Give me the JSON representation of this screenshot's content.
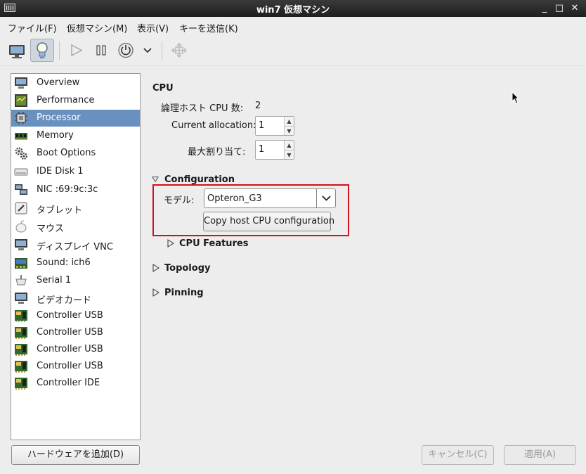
{
  "window": {
    "title": "win7 仮想マシン",
    "minimize": "_",
    "maximize": "□",
    "close": "✕"
  },
  "menu": [
    "ファイル(F)",
    "仮想マシン(M)",
    "表示(V)",
    "キーを送信(K)"
  ],
  "toolbar": [
    "console-monitor-icon",
    "details-lightbulb-icon",
    "run-icon",
    "pause-icon",
    "power-icon",
    "power-menu-chevron-icon",
    "fullscreen-icon"
  ],
  "sidebar": {
    "items": [
      {
        "label": "Overview",
        "icon": "monitor-icon"
      },
      {
        "label": "Performance",
        "icon": "performance-icon"
      },
      {
        "label": "Processor",
        "icon": "cpu-chip-icon"
      },
      {
        "label": "Memory",
        "icon": "memory-icon"
      },
      {
        "label": "Boot Options",
        "icon": "gears-icon"
      },
      {
        "label": "IDE Disk 1",
        "icon": "disk-icon"
      },
      {
        "label": "NIC :69:9c:3c",
        "icon": "network-icon"
      },
      {
        "label": "タブレット",
        "icon": "tablet-icon"
      },
      {
        "label": "マウス",
        "icon": "mouse-icon"
      },
      {
        "label": "ディスプレイ VNC",
        "icon": "display-icon"
      },
      {
        "label": "Sound: ich6",
        "icon": "sound-icon"
      },
      {
        "label": "Serial 1",
        "icon": "serial-icon"
      },
      {
        "label": "ビデオカード",
        "icon": "video-card-icon"
      },
      {
        "label": "Controller USB",
        "icon": "controller-card-icon"
      },
      {
        "label": "Controller USB",
        "icon": "controller-card-icon"
      },
      {
        "label": "Controller USB",
        "icon": "controller-card-icon"
      },
      {
        "label": "Controller USB",
        "icon": "controller-card-icon"
      },
      {
        "label": "Controller IDE",
        "icon": "controller-card-icon"
      }
    ],
    "selected": "Processor",
    "add_hardware": "ハードウェアを追加(D)"
  },
  "cpu": {
    "heading": "CPU",
    "host_label": "論理ホスト CPU 数:",
    "host_value": "2",
    "current_label": "Current allocation:",
    "current_value": "1",
    "max_label": "最大割り当て:",
    "max_value": "1"
  },
  "configuration": {
    "heading": "Configuration",
    "model_label": "モデル:",
    "model_value": "Opteron_G3",
    "copy_button": "Copy host CPU configuration",
    "cpu_features": "CPU Features"
  },
  "topology": "Topology",
  "pinning": "Pinning",
  "footer": {
    "cancel": "キャンセル(C)",
    "apply": "適用(A)"
  },
  "colors": {
    "selection": "#6a90c0",
    "highlight_box": "#d0121b"
  }
}
